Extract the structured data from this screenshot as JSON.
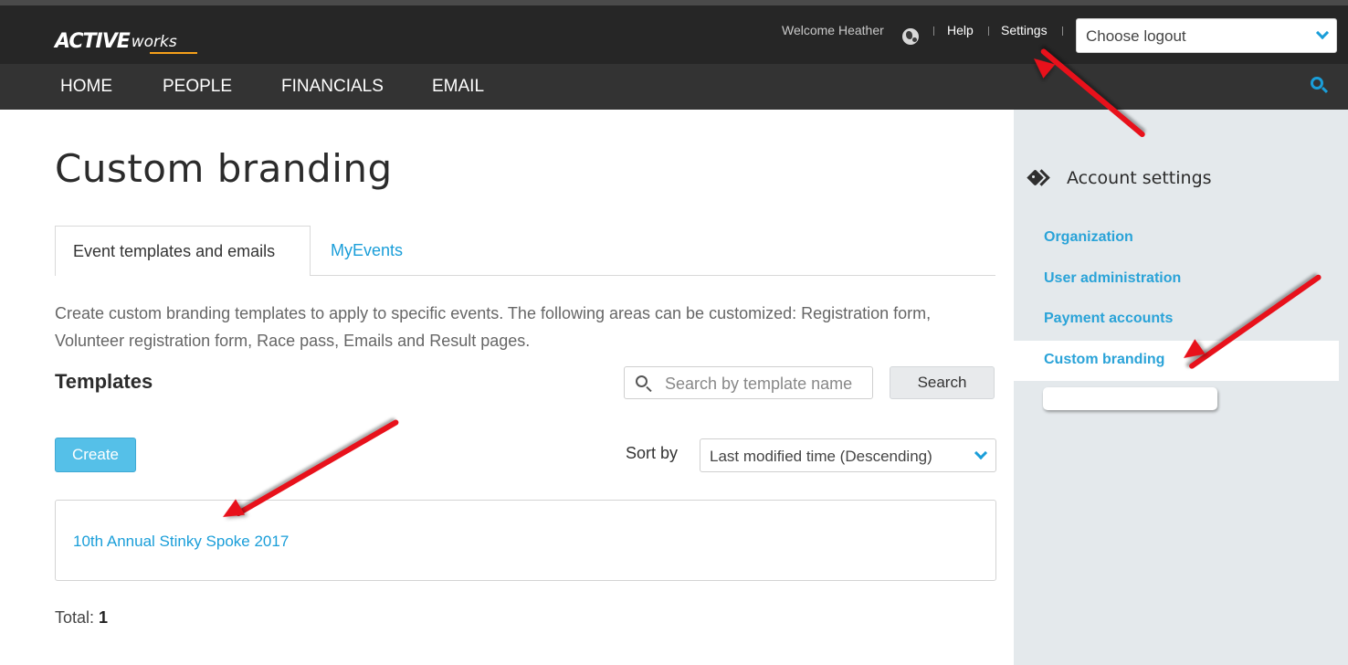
{
  "header": {
    "logo_active": "ACTIVE",
    "logo_works": "works",
    "welcome": "Welcome Heather",
    "help": "Help",
    "settings": "Settings",
    "logout_select": "Choose logout"
  },
  "nav": {
    "items": [
      "HOME",
      "PEOPLE",
      "FINANCIALS",
      "EMAIL"
    ]
  },
  "main": {
    "title": "Custom branding",
    "tabs": [
      {
        "label": "Event templates and emails",
        "active": true
      },
      {
        "label": "MyEvents",
        "active": false
      }
    ],
    "description": "Create custom branding templates to apply to specific events. The following areas can be customized: Registration form, Volunteer registration form, Race pass, Emails and Result pages.",
    "templates_heading": "Templates",
    "search": {
      "placeholder": "Search by template name",
      "button": "Search"
    },
    "create_button": "Create",
    "sort": {
      "label": "Sort by",
      "value": "Last modified time (Descending)"
    },
    "templates": [
      {
        "name": "10th Annual Stinky Spoke 2017"
      }
    ],
    "total_label": "Total:",
    "total_value": "1"
  },
  "sidebar": {
    "title": "Account settings",
    "items": [
      {
        "label": "Organization"
      },
      {
        "label": "User administration"
      },
      {
        "label": "Payment accounts"
      },
      {
        "label": "Custom branding",
        "active": true
      }
    ]
  },
  "colors": {
    "accent": "#1a9ed9",
    "topbar": "#262626",
    "navbar": "#333333",
    "sidebar": "#e4e9ec",
    "create_button": "#55c0e8",
    "annotation_arrow": "#e8111b"
  }
}
